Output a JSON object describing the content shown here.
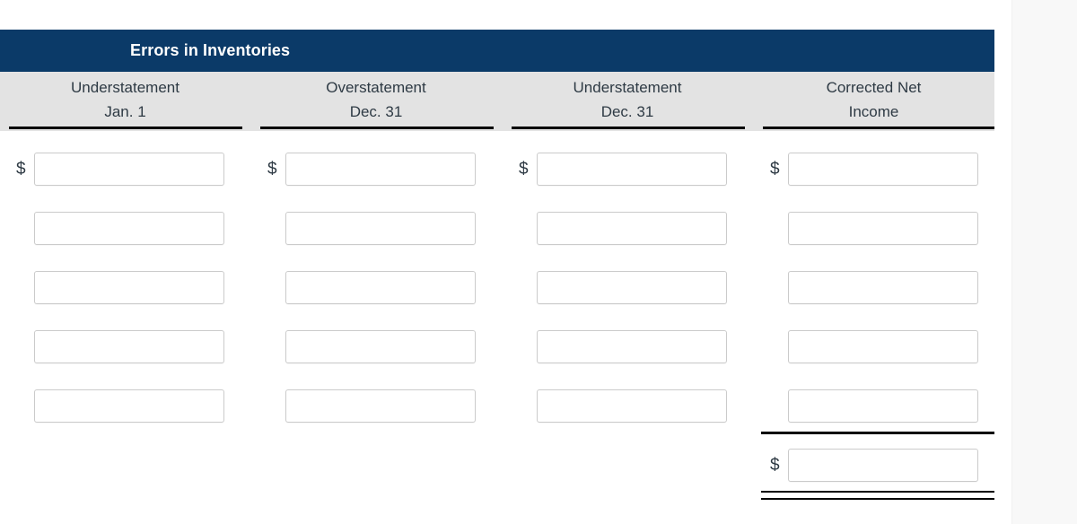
{
  "table": {
    "title": "Errors in Inventories",
    "columns": [
      {
        "line1": "Understatement",
        "line2": "Jan. 1"
      },
      {
        "line1": "Overstatement",
        "line2": "Dec. 31"
      },
      {
        "line1": "Understatement",
        "line2": "Dec. 31"
      },
      {
        "line1": "Corrected Net",
        "line2": "Income"
      }
    ],
    "currency_symbol": "$",
    "rows": [
      {
        "cells": [
          {
            "prefix": "$",
            "value": "",
            "placeholder": ""
          },
          {
            "prefix": "$",
            "value": "",
            "placeholder": ""
          },
          {
            "prefix": "$",
            "value": "",
            "placeholder": ""
          },
          {
            "prefix": "$",
            "value": "",
            "placeholder": ""
          }
        ]
      },
      {
        "cells": [
          {
            "prefix": "",
            "value": "",
            "placeholder": ""
          },
          {
            "prefix": "",
            "value": "",
            "placeholder": ""
          },
          {
            "prefix": "",
            "value": "",
            "placeholder": ""
          },
          {
            "prefix": "",
            "value": "",
            "placeholder": ""
          }
        ]
      },
      {
        "cells": [
          {
            "prefix": "",
            "value": "",
            "placeholder": ""
          },
          {
            "prefix": "",
            "value": "",
            "placeholder": ""
          },
          {
            "prefix": "",
            "value": "",
            "placeholder": ""
          },
          {
            "prefix": "",
            "value": "",
            "placeholder": ""
          }
        ]
      },
      {
        "cells": [
          {
            "prefix": "",
            "value": "",
            "placeholder": ""
          },
          {
            "prefix": "",
            "value": "",
            "placeholder": ""
          },
          {
            "prefix": "",
            "value": "",
            "placeholder": ""
          },
          {
            "prefix": "",
            "value": "",
            "placeholder": ""
          }
        ]
      },
      {
        "cells": [
          {
            "prefix": "",
            "value": "",
            "placeholder": ""
          },
          {
            "prefix": "",
            "value": "",
            "placeholder": ""
          },
          {
            "prefix": "",
            "value": "",
            "placeholder": ""
          },
          {
            "prefix": "",
            "value": "",
            "placeholder": ""
          }
        ]
      }
    ],
    "total_row": {
      "column": 4,
      "prefix": "$",
      "value": "",
      "placeholder": ""
    }
  },
  "colors": {
    "title_band": "#0b3a68",
    "title_text": "#ffffff",
    "header_band": "#e3e3e3",
    "header_text": "#2e3a44",
    "rule": "#000000",
    "field_border": "#cbcbcb",
    "page_background": "#f8f8f8",
    "content_background": "#ffffff"
  }
}
